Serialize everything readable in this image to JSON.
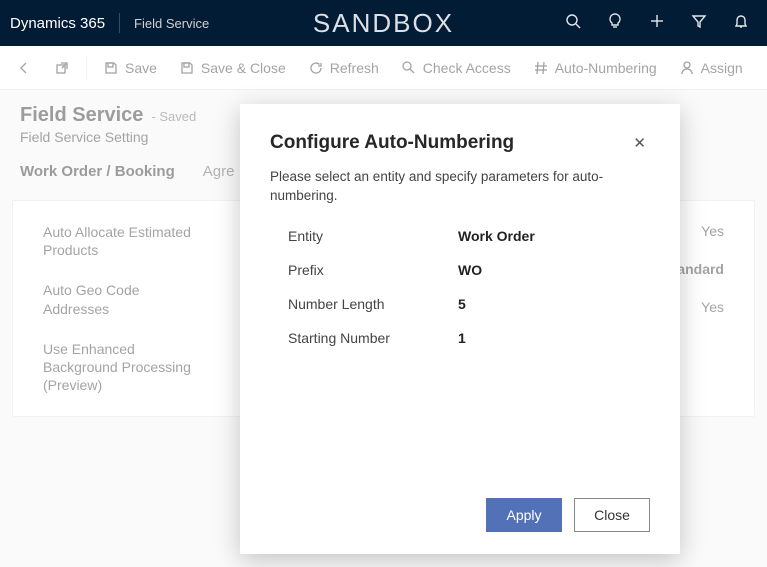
{
  "header": {
    "app": "Dynamics 365",
    "module": "Field Service",
    "environment": "SANDBOX"
  },
  "commandbar": {
    "save": "Save",
    "save_close": "Save & Close",
    "refresh": "Refresh",
    "check_access": "Check Access",
    "auto_numbering": "Auto-Numbering",
    "assign": "Assign"
  },
  "page": {
    "title": "Field Service",
    "status": "- Saved",
    "subtitle": "Field Service Setting",
    "tabs": [
      "Work Order / Booking",
      "Agre"
    ]
  },
  "form": {
    "left": [
      {
        "label": "Auto Allocate Estimated Products",
        "toggle": "off"
      },
      {
        "label": "Auto Geo Code Addresses",
        "toggle": "on"
      },
      {
        "label": "Use Enhanced Background Processing (Preview)",
        "toggle": "on"
      }
    ],
    "right": [
      {
        "label": "",
        "value": "Yes"
      },
      {
        "label": "",
        "value": "/Standard"
      },
      {
        "label": "",
        "value": "Yes"
      }
    ]
  },
  "dialog": {
    "title": "Configure Auto-Numbering",
    "description": "Please select an entity and specify parameters for auto-numbering.",
    "fields": {
      "entity_label": "Entity",
      "entity_value": "Work Order",
      "prefix_label": "Prefix",
      "prefix_value": "WO",
      "length_label": "Number Length",
      "length_value": "5",
      "start_label": "Starting Number",
      "start_value": "1"
    },
    "apply": "Apply",
    "close": "Close"
  }
}
